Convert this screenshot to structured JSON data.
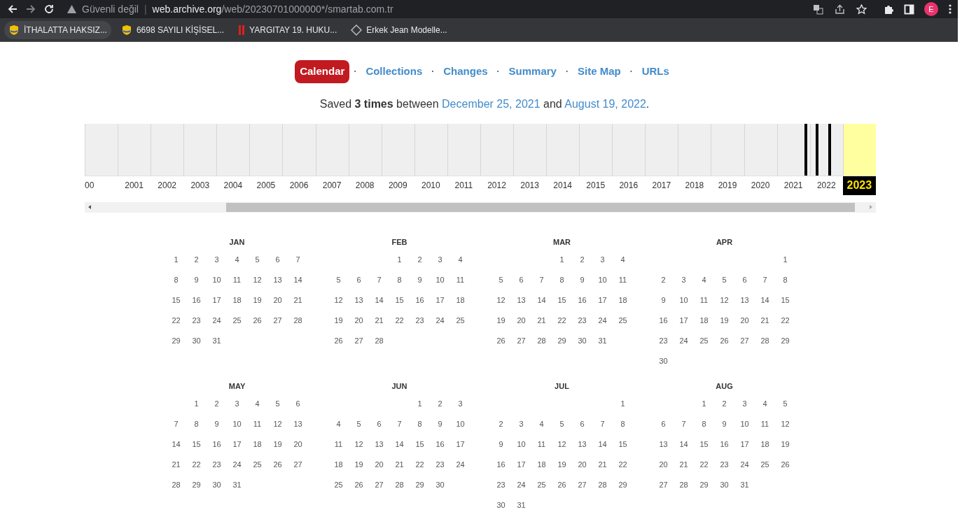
{
  "browser": {
    "security": "Güvenli değil",
    "divider": "|",
    "url_host": "web.archive.org",
    "url_path": "/web/20230701000000*/smartab.com.tr",
    "profile": "E"
  },
  "bookmarks": [
    {
      "label": "İTHALATTA HAKSIZ...",
      "kind": "shield"
    },
    {
      "label": "6698 SAYILI KİŞİSEL...",
      "kind": "shield"
    },
    {
      "label": "YARGITAY 19. HUKU...",
      "kind": "bars"
    },
    {
      "label": "Erkek Jean Modelle...",
      "kind": "diamond"
    }
  ],
  "tabs": [
    {
      "label": "Calendar",
      "selected": true
    },
    {
      "separator": "·",
      "label": "Collections",
      "selected": false
    },
    {
      "separator": "·",
      "label": "Changes",
      "selected": false
    },
    {
      "separator": "·",
      "label": "Summary",
      "selected": false
    },
    {
      "separator": "·",
      "label": "Site Map",
      "selected": false
    },
    {
      "separator": "·",
      "label": "URLs",
      "selected": false
    }
  ],
  "summary": {
    "before": "Saved ",
    "count": "3 times",
    "middle": " between ",
    "first": "December 25, 2021",
    "and": " and ",
    "last": "August 19, 2022",
    "end": "."
  },
  "years": [
    {
      "label": "00",
      "selected": false
    },
    {
      "label": "2001",
      "selected": false
    },
    {
      "label": "2002",
      "selected": false
    },
    {
      "label": "2003",
      "selected": false
    },
    {
      "label": "2004",
      "selected": false
    },
    {
      "label": "2005",
      "selected": false
    },
    {
      "label": "2006",
      "selected": false
    },
    {
      "label": "2007",
      "selected": false
    },
    {
      "label": "2008",
      "selected": false
    },
    {
      "label": "2009",
      "selected": false
    },
    {
      "label": "2010",
      "selected": false
    },
    {
      "label": "2011",
      "selected": false
    },
    {
      "label": "2012",
      "selected": false
    },
    {
      "label": "2013",
      "selected": false
    },
    {
      "label": "2014",
      "selected": false
    },
    {
      "label": "2015",
      "selected": false
    },
    {
      "label": "2016",
      "selected": false
    },
    {
      "label": "2017",
      "selected": false
    },
    {
      "label": "2018",
      "selected": false
    },
    {
      "label": "2019",
      "selected": false
    },
    {
      "label": "2020",
      "selected": false
    },
    {
      "label": "2021",
      "selected": false
    },
    {
      "label": "2022",
      "selected": false
    },
    {
      "label": "2023",
      "selected": true
    }
  ],
  "months": [
    {
      "name": "JAN",
      "weeks": [
        {
          "kind": "first",
          "days": [
            "1",
            "2",
            "3",
            "4",
            "5",
            "6",
            "7"
          ]
        },
        {
          "kind": "full",
          "days": [
            "8",
            "9",
            "10",
            "11",
            "12",
            "13",
            "14"
          ]
        },
        {
          "kind": "full",
          "days": [
            "15",
            "16",
            "17",
            "18",
            "19",
            "20",
            "21"
          ]
        },
        {
          "kind": "full",
          "days": [
            "22",
            "23",
            "24",
            "25",
            "26",
            "27",
            "28"
          ]
        },
        {
          "kind": "full",
          "days": [
            "29",
            "30",
            "31"
          ]
        }
      ]
    },
    {
      "name": "FEB",
      "weeks": [
        {
          "kind": "first",
          "days": [
            "1",
            "2",
            "3",
            "4"
          ]
        },
        {
          "kind": "full",
          "days": [
            "5",
            "6",
            "7",
            "8",
            "9",
            "10",
            "11"
          ]
        },
        {
          "kind": "full",
          "days": [
            "12",
            "13",
            "14",
            "15",
            "16",
            "17",
            "18"
          ]
        },
        {
          "kind": "full",
          "days": [
            "19",
            "20",
            "21",
            "22",
            "23",
            "24",
            "25"
          ]
        },
        {
          "kind": "full",
          "days": [
            "26",
            "27",
            "28"
          ]
        }
      ]
    },
    {
      "name": "MAR",
      "weeks": [
        {
          "kind": "first",
          "days": [
            "1",
            "2",
            "3",
            "4"
          ]
        },
        {
          "kind": "full",
          "days": [
            "5",
            "6",
            "7",
            "8",
            "9",
            "10",
            "11"
          ]
        },
        {
          "kind": "full",
          "days": [
            "12",
            "13",
            "14",
            "15",
            "16",
            "17",
            "18"
          ]
        },
        {
          "kind": "full",
          "days": [
            "19",
            "20",
            "21",
            "22",
            "23",
            "24",
            "25"
          ]
        },
        {
          "kind": "full",
          "days": [
            "26",
            "27",
            "28",
            "29",
            "30",
            "31"
          ]
        }
      ]
    },
    {
      "name": "APR",
      "weeks": [
        {
          "kind": "first",
          "days": [
            "1"
          ]
        },
        {
          "kind": "full",
          "days": [
            "2",
            "3",
            "4",
            "5",
            "6",
            "7",
            "8"
          ]
        },
        {
          "kind": "full",
          "days": [
            "9",
            "10",
            "11",
            "12",
            "13",
            "14",
            "15"
          ]
        },
        {
          "kind": "full",
          "days": [
            "16",
            "17",
            "18",
            "19",
            "20",
            "21",
            "22"
          ]
        },
        {
          "kind": "full",
          "days": [
            "23",
            "24",
            "25",
            "26",
            "27",
            "28",
            "29"
          ]
        },
        {
          "kind": "full",
          "days": [
            "30"
          ]
        }
      ]
    },
    {
      "name": "MAY",
      "weeks": [
        {
          "kind": "first",
          "days": [
            "1",
            "2",
            "3",
            "4",
            "5",
            "6"
          ]
        },
        {
          "kind": "full",
          "days": [
            "7",
            "8",
            "9",
            "10",
            "11",
            "12",
            "13"
          ]
        },
        {
          "kind": "full",
          "days": [
            "14",
            "15",
            "16",
            "17",
            "18",
            "19",
            "20"
          ]
        },
        {
          "kind": "full",
          "days": [
            "21",
            "22",
            "23",
            "24",
            "25",
            "26",
            "27"
          ]
        },
        {
          "kind": "full",
          "days": [
            "28",
            "29",
            "30",
            "31"
          ]
        }
      ]
    },
    {
      "name": "JUN",
      "weeks": [
        {
          "kind": "first",
          "days": [
            "1",
            "2",
            "3"
          ]
        },
        {
          "kind": "full",
          "days": [
            "4",
            "5",
            "6",
            "7",
            "8",
            "9",
            "10"
          ]
        },
        {
          "kind": "full",
          "days": [
            "11",
            "12",
            "13",
            "14",
            "15",
            "16",
            "17"
          ]
        },
        {
          "kind": "full",
          "days": [
            "18",
            "19",
            "20",
            "21",
            "22",
            "23",
            "24"
          ]
        },
        {
          "kind": "full",
          "days": [
            "25",
            "26",
            "27",
            "28",
            "29",
            "30"
          ]
        }
      ]
    },
    {
      "name": "JUL",
      "weeks": [
        {
          "kind": "first",
          "days": [
            "1"
          ]
        },
        {
          "kind": "full",
          "days": [
            "2",
            "3",
            "4",
            "5",
            "6",
            "7",
            "8"
          ]
        },
        {
          "kind": "full",
          "days": [
            "9",
            "10",
            "11",
            "12",
            "13",
            "14",
            "15"
          ]
        },
        {
          "kind": "full",
          "days": [
            "16",
            "17",
            "18",
            "19",
            "20",
            "21",
            "22"
          ]
        },
        {
          "kind": "full",
          "days": [
            "23",
            "24",
            "25",
            "26",
            "27",
            "28",
            "29"
          ]
        },
        {
          "kind": "full",
          "days": [
            "30",
            "31"
          ]
        }
      ]
    },
    {
      "name": "AUG",
      "weeks": [
        {
          "kind": "first",
          "days": [
            "1",
            "2",
            "3",
            "4",
            "5"
          ]
        },
        {
          "kind": "full",
          "days": [
            "6",
            "7",
            "8",
            "9",
            "10",
            "11",
            "12"
          ]
        },
        {
          "kind": "full",
          "days": [
            "13",
            "14",
            "15",
            "16",
            "17",
            "18",
            "19"
          ]
        },
        {
          "kind": "full",
          "days": [
            "20",
            "21",
            "22",
            "23",
            "24",
            "25",
            "26"
          ]
        },
        {
          "kind": "full",
          "days": [
            "27",
            "28",
            "29",
            "30",
            "31"
          ]
        }
      ]
    }
  ]
}
